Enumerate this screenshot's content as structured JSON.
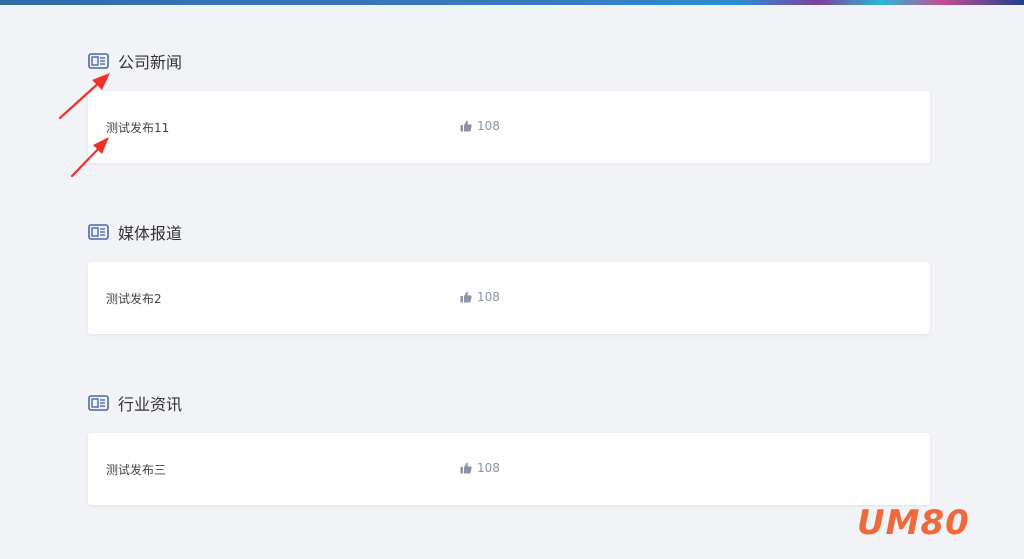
{
  "sections": [
    {
      "title": "公司新闻",
      "item": {
        "title": "测试发布11",
        "likes": "108"
      }
    },
    {
      "title": "媒体报道",
      "item": {
        "title": "测试发布2",
        "likes": "108"
      }
    },
    {
      "title": "行业资讯",
      "item": {
        "title": "测试发布三",
        "likes": "108"
      }
    }
  ],
  "watermark": "UM80",
  "colors": {
    "background": "#f2f3f7",
    "card": "#ffffff",
    "icon": "#4a6aa8",
    "like": "#8a94a6",
    "annotation_arrow": "#f0302a",
    "watermark": "#ee6a3c"
  },
  "icons": {
    "section": "newspaper-icon",
    "like": "thumbs-up-icon"
  }
}
